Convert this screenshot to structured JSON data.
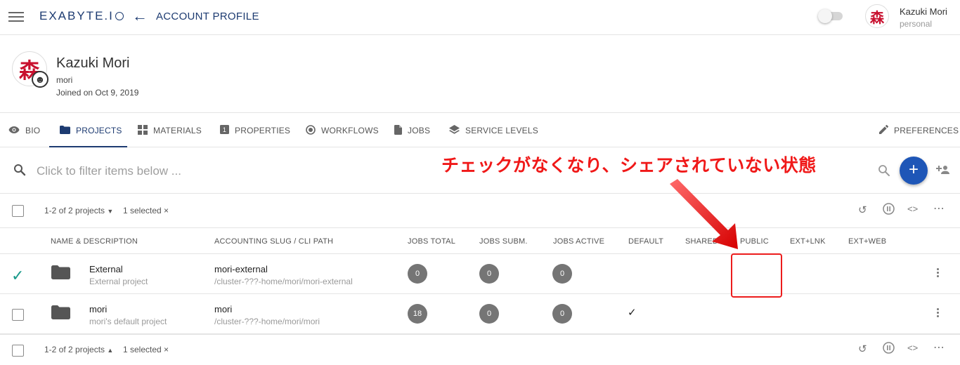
{
  "header": {
    "logo": "EXABYTE.I",
    "page_title": "ACCOUNT PROFILE",
    "user_name": "Kazuki Mori",
    "user_account": "personal"
  },
  "profile": {
    "name": "Kazuki Mori",
    "username": "mori",
    "joined": "Joined on Oct 9, 2019",
    "avatar_glyph": "森"
  },
  "tabs": [
    {
      "label": "BIO",
      "icon": "eye-icon"
    },
    {
      "label": "PROJECTS",
      "icon": "folder-icon"
    },
    {
      "label": "MATERIALS",
      "icon": "grid-icon"
    },
    {
      "label": "PROPERTIES",
      "icon": "number-box-icon"
    },
    {
      "label": "WORKFLOWS",
      "icon": "radio-icon"
    },
    {
      "label": "JOBS",
      "icon": "file-icon"
    },
    {
      "label": "SERVICE LEVELS",
      "icon": "layers-icon"
    },
    {
      "label": "PREFERENCES",
      "icon": "pencil-icon"
    }
  ],
  "active_tab": "PROJECTS",
  "filter": {
    "placeholder": "Click to filter items below ..."
  },
  "pagination": {
    "range": "1-2 of 2 projects",
    "selected": "1 selected ×"
  },
  "columns": {
    "name": "NAME & DESCRIPTION",
    "slug": "ACCOUNTING SLUG / CLI PATH",
    "jobs_total": "JOBS TOTAL",
    "jobs_subm": "JOBS SUBM.",
    "jobs_active": "JOBS ACTIVE",
    "default": "DEFAULT",
    "shared": "SHARED",
    "public": "PUBLIC",
    "ext_lnk": "EXT+LNK",
    "ext_web": "EXT+WEB"
  },
  "rows": [
    {
      "name": "External",
      "description": "External project",
      "slug": "mori-external",
      "path": "/cluster-???-home/mori/mori-external",
      "jobs_total": "0",
      "jobs_subm": "0",
      "jobs_active": "0",
      "selected": true,
      "default_mark": ""
    },
    {
      "name": "mori",
      "description": "mori's default project",
      "slug": "mori",
      "path": "/cluster-???-home/mori/mori",
      "jobs_total": "18",
      "jobs_subm": "0",
      "jobs_active": "0",
      "selected": false,
      "default_mark": "✓"
    }
  ],
  "annotation": {
    "text": "チェックがなくなり、シェアされていない状態",
    "color": "#f01818"
  },
  "colors": {
    "brand": "#1d3b71",
    "fab": "#1e56b7",
    "pill": "#757575",
    "check": "#1a9a8a"
  }
}
